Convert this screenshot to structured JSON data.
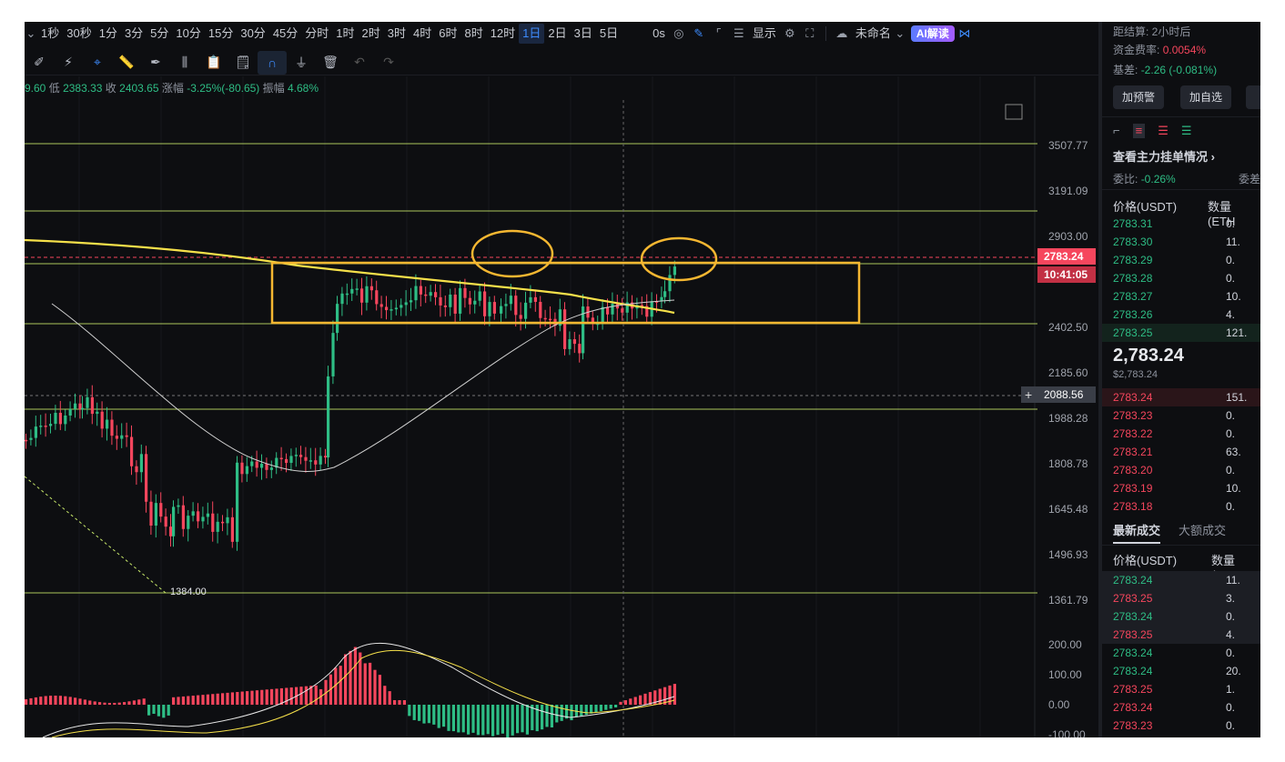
{
  "toolbar": {
    "timeframes": [
      "1秒",
      "30秒",
      "1分",
      "3分",
      "5分",
      "10分",
      "15分",
      "30分",
      "45分",
      "分时",
      "1时",
      "2时",
      "3时",
      "4时",
      "6时",
      "8时",
      "12时",
      "1日",
      "2日",
      "3日",
      "5日"
    ],
    "active_timeframe": "1日",
    "countdown_label": "0s",
    "display_label": "显示",
    "layout_name": "未命名",
    "ai_label": "AI解读"
  },
  "ohlc": {
    "prefix": "9.60",
    "low_label": "低",
    "low": "2383.33",
    "close_label": "收",
    "close": "2403.65",
    "change_label": "涨幅",
    "change": "-3.25%(-80.65)",
    "amp_label": "振幅",
    "amp": "4.68%"
  },
  "price_axis": {
    "ticks": [
      "3507.77",
      "3191.09",
      "2903.00",
      "2402.50",
      "2185.60",
      "1988.28",
      "1808.78",
      "1645.48",
      "1496.93",
      "1361.79"
    ],
    "current_price": "2783.24",
    "countdown": "10:41:05",
    "crosshair_price": "2088.56",
    "low_marker": "1384.00",
    "macd_ticks": [
      "200.00",
      "100.00",
      "0.00",
      "-100.00"
    ]
  },
  "side": {
    "settle_label": "距结算: 2小时后",
    "funding_label": "资金费率:",
    "funding_value": "0.0054%",
    "basis_label": "基差:",
    "basis_value": "-2.26 (-0.081%)",
    "alert_button": "加预警",
    "watch_button": "加自选",
    "main_orders_link": "查看主力挂单情况 ›",
    "ratio_label": "委比:",
    "ratio_value": "-0.26%",
    "ratio_right": "委差",
    "price_header": "价格(USDT)",
    "qty_header": "数量 (ETH",
    "asks": [
      {
        "p": "2783.31",
        "q": "0."
      },
      {
        "p": "2783.30",
        "q": "11."
      },
      {
        "p": "2783.29",
        "q": "0."
      },
      {
        "p": "2783.28",
        "q": "0."
      },
      {
        "p": "2783.27",
        "q": "10."
      },
      {
        "p": "2783.26",
        "q": "4."
      },
      {
        "p": "2783.25",
        "q": "121."
      }
    ],
    "last_price": "2,783.24",
    "last_price_usd": "$2,783.24",
    "bids": [
      {
        "p": "2783.24",
        "q": "151."
      },
      {
        "p": "2783.23",
        "q": "0."
      },
      {
        "p": "2783.22",
        "q": "0."
      },
      {
        "p": "2783.21",
        "q": "63."
      },
      {
        "p": "2783.20",
        "q": "0."
      },
      {
        "p": "2783.19",
        "q": "10."
      },
      {
        "p": "2783.18",
        "q": "0."
      }
    ],
    "trades_tab": "最新成交",
    "big_trades_tab": "大额成交",
    "trades_price_header": "价格(USDT)",
    "trades_qty_header": "数量(ETH",
    "trades": [
      {
        "p": "2783.24",
        "q": "11.",
        "side": "buy"
      },
      {
        "p": "2783.25",
        "q": "3.",
        "side": "sell"
      },
      {
        "p": "2783.24",
        "q": "0.",
        "side": "buy"
      },
      {
        "p": "2783.25",
        "q": "4.",
        "side": "sell"
      },
      {
        "p": "2783.24",
        "q": "0.",
        "side": "buy"
      },
      {
        "p": "2783.24",
        "q": "20.",
        "side": "buy"
      },
      {
        "p": "2783.25",
        "q": "1.",
        "side": "sell"
      },
      {
        "p": "2783.24",
        "q": "0.",
        "side": "sell"
      },
      {
        "p": "2783.23",
        "q": "0.",
        "side": "sell"
      }
    ]
  },
  "colors": {
    "up": "#2ebd85",
    "down": "#f6465d",
    "highlight": "#f5b731",
    "hline": "#c8e86a"
  }
}
